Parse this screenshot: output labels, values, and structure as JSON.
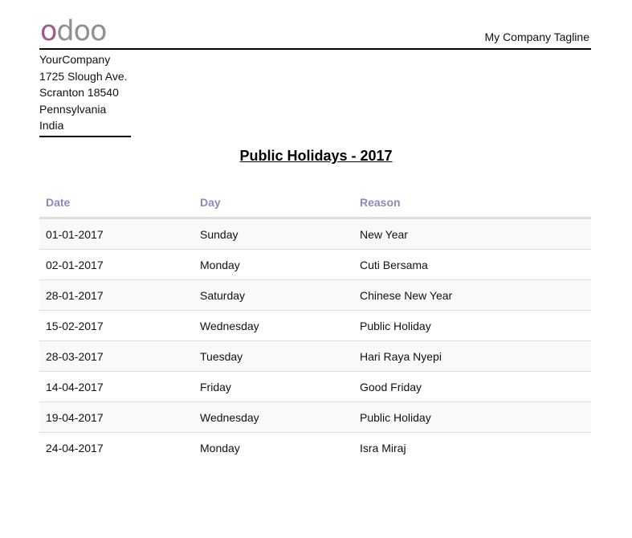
{
  "header": {
    "logo_text": "odoo",
    "tagline": "My Company Tagline"
  },
  "address": {
    "company": "YourCompany",
    "street": "1725 Slough Ave.",
    "city_zip": "Scranton 18540",
    "state": "Pennsylvania",
    "country": "India"
  },
  "title": "Public Holidays - 2017",
  "table": {
    "headers": [
      "Date",
      "Day",
      "Reason"
    ],
    "rows": [
      [
        "01-01-2017",
        "Sunday",
        "New Year"
      ],
      [
        "02-01-2017",
        "Monday",
        "Cuti Bersama"
      ],
      [
        "28-01-2017",
        "Saturday",
        "Chinese New Year"
      ],
      [
        "15-02-2017",
        "Wednesday",
        "Public Holiday"
      ],
      [
        "28-03-2017",
        "Tuesday",
        "Hari Raya Nyepi"
      ],
      [
        "14-04-2017",
        "Friday",
        "Good Friday"
      ],
      [
        "19-04-2017",
        "Wednesday",
        "Public Holiday"
      ],
      [
        "24-04-2017",
        "Monday",
        "Isra Miraj"
      ]
    ]
  },
  "colors": {
    "logo_purple": "#9c5a8f",
    "logo_gray": "#8f8f8f",
    "header_text": "#8a8ab8"
  }
}
